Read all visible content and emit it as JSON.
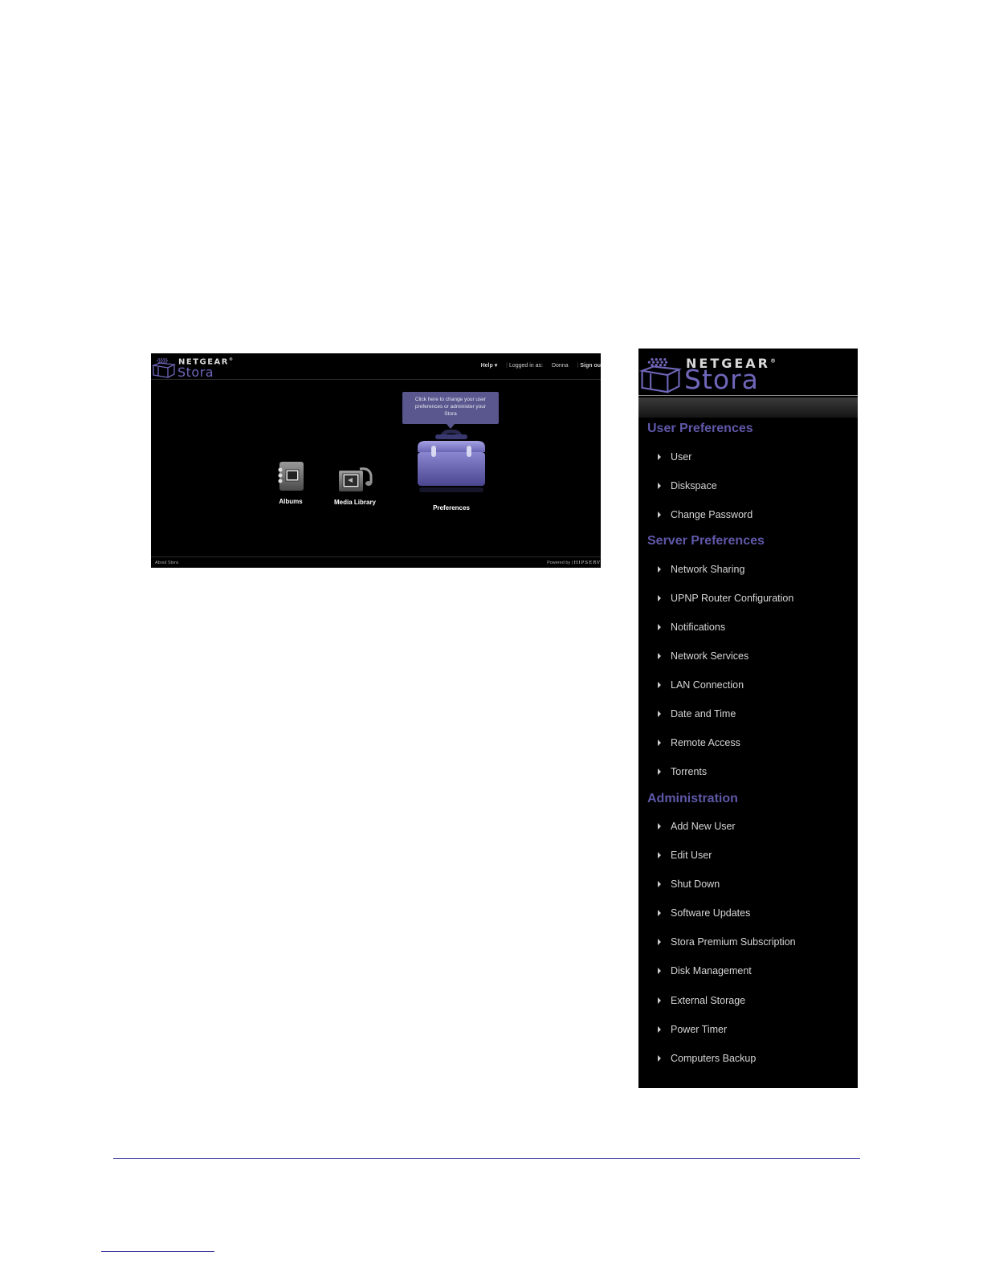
{
  "home": {
    "logo": {
      "brand": "NETGEAR",
      "product": "Stora"
    },
    "topnav": {
      "help": "Help",
      "help_caret": "▾",
      "logged_in_label": "Logged in as:",
      "user": "Donna",
      "sign_out": "Sign ou"
    },
    "tooltip": "Click here to change your user preferences or administer your Stora",
    "apps": {
      "albums": "Albums",
      "media_library": "Media Library",
      "preferences": "Preferences"
    },
    "footer": {
      "about": "About Stora",
      "powered_by": "Powered by",
      "powered_brand": "HIPSERV"
    }
  },
  "menu": {
    "logo": {
      "brand": "NETGEAR",
      "product": "Stora"
    },
    "sections": [
      {
        "title": "User Preferences",
        "items": [
          "User",
          "Diskspace",
          "Change Password"
        ]
      },
      {
        "title": "Server Preferences",
        "items": [
          "Network Sharing",
          "UPNP Router Configuration",
          "Notifications",
          "Network Services",
          "LAN Connection",
          "Date and Time",
          "Remote Access",
          "Torrents"
        ]
      },
      {
        "title": "Administration",
        "items": [
          "Add New User",
          "Edit User",
          "Shut Down",
          "Software Updates",
          "Stora Premium Subscription",
          "Disk Management",
          "External Storage",
          "Power Timer",
          "Computers Backup"
        ]
      }
    ]
  },
  "colors": {
    "accent": "#5e58a8",
    "tooltip": "#5a578f",
    "rule": "#3a3aa0"
  }
}
